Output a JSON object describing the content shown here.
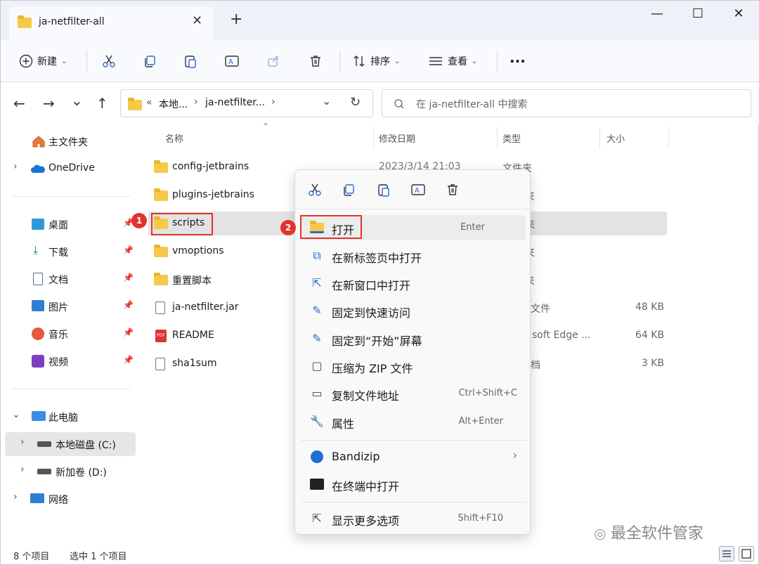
{
  "window": {
    "tab_title": "ja-netfilter-all",
    "new_tab": "+",
    "minimize": "—",
    "maximize": "☐",
    "close": "✕",
    "tab_close": "✕"
  },
  "toolbar": {
    "new_label": "新建",
    "sort_label": "排序",
    "view_label": "查看",
    "more": "···"
  },
  "address": {
    "back": "←",
    "forward": "→",
    "recent": "⌄",
    "up": "↑",
    "crumb_overflow": "«",
    "crumb_1": "本地...",
    "crumb_sep": "›",
    "crumb_2": "ja-netfilter...",
    "crumb_3_sep": "›",
    "dropdown": "⌄",
    "refresh": "↻",
    "search_placeholder": "在 ja-netfilter-all 中搜索"
  },
  "sidebar": {
    "items": [
      {
        "label": "主文件夹",
        "icon": "home-icon"
      },
      {
        "label": "OneDrive",
        "icon": "cloud-icon",
        "expand": "›"
      },
      {
        "label": "桌面",
        "icon": "desktop-icon",
        "pin": true
      },
      {
        "label": "下载",
        "icon": "download-icon",
        "pin": true
      },
      {
        "label": "文档",
        "icon": "document-icon",
        "pin": true
      },
      {
        "label": "图片",
        "icon": "picture-icon",
        "pin": true
      },
      {
        "label": "音乐",
        "icon": "music-icon",
        "pin": true
      },
      {
        "label": "视频",
        "icon": "video-icon",
        "pin": true
      },
      {
        "label": "此电脑",
        "icon": "computer-icon",
        "expand": "⌄"
      },
      {
        "label": "本地磁盘 (C:)",
        "icon": "drive-icon",
        "expand": "›"
      },
      {
        "label": "新加卷 (D:)",
        "icon": "drive-icon",
        "expand": "›"
      },
      {
        "label": "网络",
        "icon": "network-icon",
        "expand": "›"
      }
    ]
  },
  "columns": {
    "name": "名称",
    "date": "修改日期",
    "type": "类型",
    "size": "大小"
  },
  "files": [
    {
      "name": "config-jetbrains",
      "date": "2023/3/14 21:03",
      "type": "文件夹",
      "size": ""
    },
    {
      "name": "plugins-jetbrains",
      "date": "",
      "type": "夹",
      "size": ""
    },
    {
      "name": "scripts",
      "date": "",
      "type": "夹",
      "size": ""
    },
    {
      "name": "vmoptions",
      "date": "",
      "type": "夹",
      "size": ""
    },
    {
      "name": "重置脚本",
      "date": "",
      "type": "夹",
      "size": ""
    },
    {
      "name": "ja-netfilter.jar",
      "date": "",
      "type": "文件",
      "size": "48 KB"
    },
    {
      "name": "README",
      "date": "",
      "type": "soft Edge ...",
      "size": "64 KB"
    },
    {
      "name": "sha1sum",
      "date": "",
      "type": "档",
      "size": "3 KB"
    }
  ],
  "status": {
    "count": "8 个项目",
    "selected": "选中 1 个项目"
  },
  "context_menu": {
    "items": [
      {
        "label": "打开",
        "shortcut": "Enter",
        "icon": "folder-open-icon"
      },
      {
        "label": "在新标签页中打开",
        "shortcut": "",
        "icon": "new-tab-icon"
      },
      {
        "label": "在新窗口中打开",
        "shortcut": "",
        "icon": "new-window-icon"
      },
      {
        "label": "固定到快速访问",
        "shortcut": "",
        "icon": "pin-icon"
      },
      {
        "label": "固定到“开始”屏幕",
        "shortcut": "",
        "icon": "pin-icon"
      },
      {
        "label": "压缩为 ZIP 文件",
        "shortcut": "",
        "icon": "zip-icon"
      },
      {
        "label": "复制文件地址",
        "shortcut": "Ctrl+Shift+C",
        "icon": "copy-path-icon"
      },
      {
        "label": "属性",
        "shortcut": "Alt+Enter",
        "icon": "wrench-icon"
      },
      {
        "label": "Bandizip",
        "shortcut": "›",
        "icon": "bandizip-icon"
      },
      {
        "label": "在终端中打开",
        "shortcut": "",
        "icon": "terminal-icon"
      },
      {
        "label": "显示更多选项",
        "shortcut": "Shift+F10",
        "icon": "more-options-icon"
      }
    ]
  },
  "annotations": {
    "badge_1": "1",
    "badge_2": "2"
  },
  "watermark": "最全软件管家"
}
